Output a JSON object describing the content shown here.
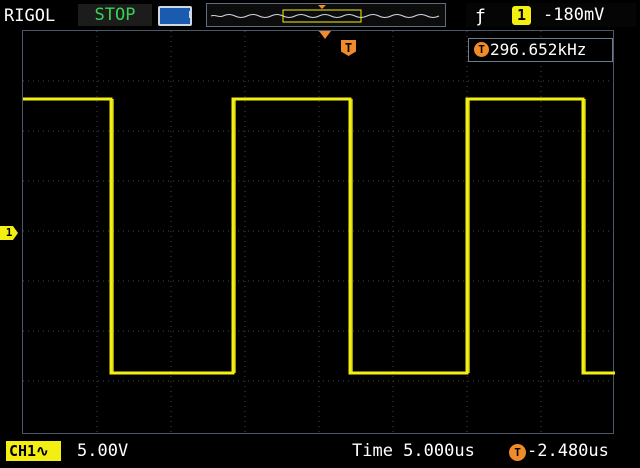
{
  "header": {
    "brand": "RIGOL",
    "run_state": "STOP",
    "trigger": {
      "edge_icon": "rising-edge-icon",
      "channel": "1",
      "level": "-180mV"
    }
  },
  "measure": {
    "icon_label": "T",
    "frequency": "296.652kHz"
  },
  "markers": {
    "trigger_position": "T",
    "channel": "1"
  },
  "footer": {
    "channel_label": "CH1",
    "channel_coupling_icon": "ac-coupling-icon",
    "volts_per_div": "5.00V",
    "timebase": "Time 5.000us",
    "offset_icon_label": "T",
    "horizontal_offset": "-2.480us"
  },
  "colors": {
    "trace": "#f4ef12",
    "grid": "#3f4654",
    "status": "#39d353",
    "accent": "#f08a2b"
  }
}
